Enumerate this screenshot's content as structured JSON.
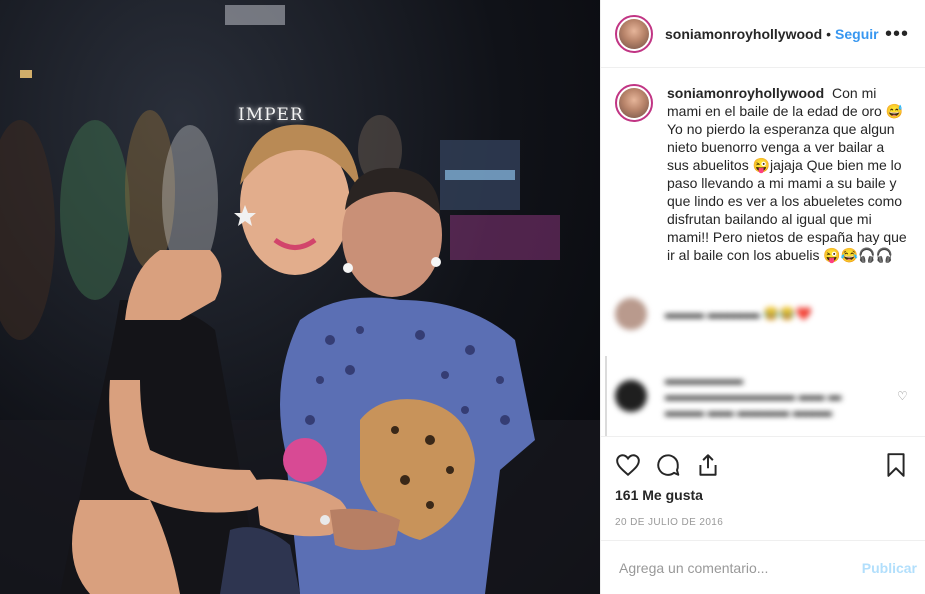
{
  "header": {
    "username": "soniamonroyhollywood",
    "separator": "•",
    "follow_label": "Seguir",
    "more_label": "•••"
  },
  "photo": {
    "sign_text": "IMPER"
  },
  "caption": {
    "username": "soniamonroyhollywood",
    "text": "Con mi mami en el baile de la edad de oro 😅Yo no pierdo la esperanza que algun nieto buenorro venga a ver bailar a sus abuelitos 😜jajaja Que bien me lo paso llevando a mi mami a su baile y que lindo es ver a los abueletes como disfrutan bailando al igual que mi mami!! Pero nietos de españa hay que ir al baile con los abuelis 😜😂🎧🎧"
  },
  "actions": {
    "likes": "161 Me gusta",
    "date": "20 DE JULIO DE 2016"
  },
  "comment_box": {
    "placeholder": "Agrega un comentario...",
    "post_label": "Publicar"
  },
  "colors": {
    "accent": "#3897f0",
    "publish_disabled": "#b2dffc",
    "story_ring": "#c13584"
  },
  "icons": [
    "heart-icon",
    "comment-icon",
    "share-icon",
    "bookmark-icon",
    "more-icon"
  ]
}
